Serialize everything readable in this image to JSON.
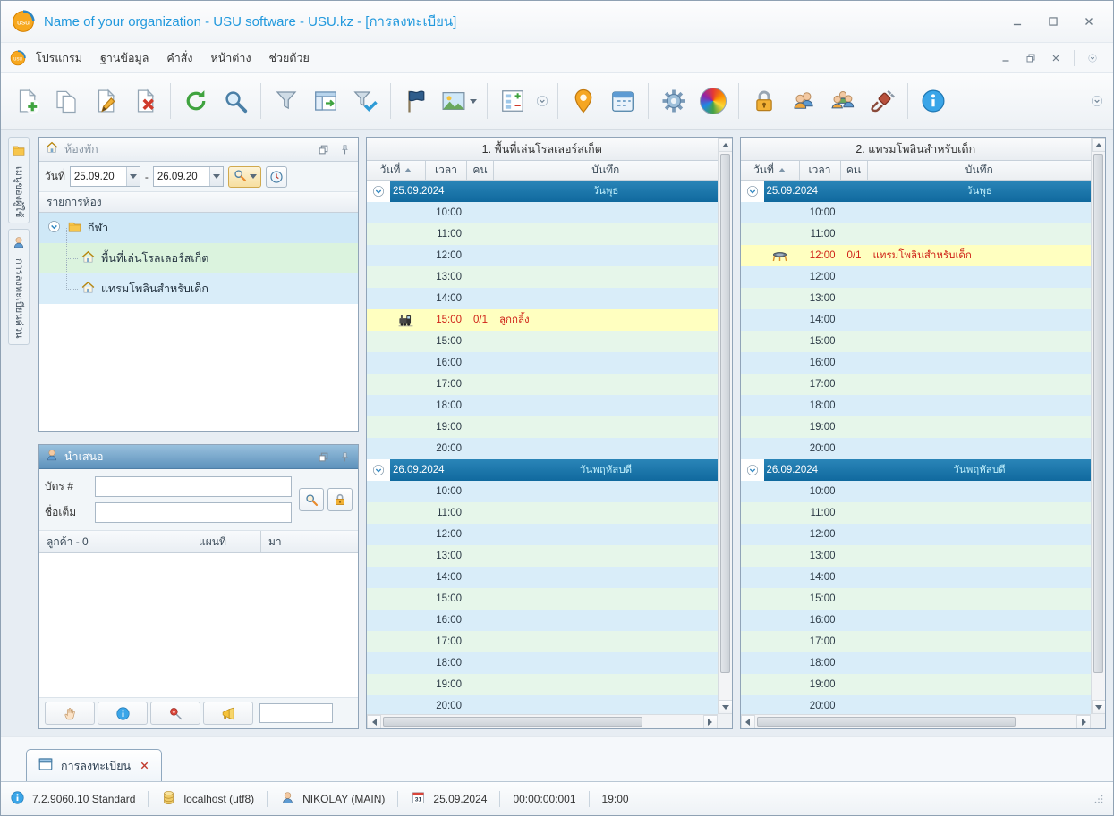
{
  "colors": {
    "title_text": "#2299dd",
    "date_band": "#10699e",
    "row_blue": "#d9edf9",
    "row_green": "#e6f6ea",
    "booking_bg": "#ffffc0",
    "booking_text": "#cf2217"
  },
  "titlebar": {
    "title": "Name of your organization - USU software - USU.kz - [การลงทะเบียน]"
  },
  "menubar": {
    "items": [
      "โปรแกรม",
      "ฐานข้อมูล",
      "คำสั่ง",
      "หน้าต่าง",
      "ช่วยด้วย"
    ]
  },
  "toolbar": {
    "groups": [
      [
        "add",
        "copy",
        "edit",
        "delete"
      ],
      [
        "refresh",
        "search"
      ],
      [
        "filter",
        "layout",
        "filter-check"
      ],
      [
        "flag",
        "image-drop"
      ],
      [
        "counter",
        "chevron-sm"
      ],
      [
        "location",
        "calendar"
      ],
      [
        "settings",
        "colorwheel"
      ],
      [
        "lock",
        "users2",
        "users3",
        "plug"
      ],
      [
        "info"
      ]
    ]
  },
  "dock_tabs": [
    {
      "label": "เมนูของผู้ใช้",
      "icon": "folder-icon"
    },
    {
      "label": "การลงทะเบียนด่วน",
      "icon": "person-icon"
    }
  ],
  "rooms_panel": {
    "title": "ห้องพัก",
    "date_label": "วันที่",
    "date_from": "25.09.20",
    "date_to": "26.09.20",
    "list_header": "รายการห้อง",
    "group": "กีฬา",
    "rooms": [
      "พื้นที่เล่นโรลเลอร์สเก็ต",
      "แทรมโพลินสำหรับเด็ก"
    ]
  },
  "present_panel": {
    "title": "นำเสนอ",
    "card_label": "บัตร #",
    "fullname_label": "ชื่อเต็ม",
    "columns": [
      "ลูกค้า - 0",
      "แผนที่",
      "มา"
    ]
  },
  "schedules": {
    "columns": {
      "date": "วันที่",
      "time": "เวลา",
      "people": "คน",
      "note": "บันทึก"
    },
    "times": [
      "10:00",
      "11:00",
      "12:00",
      "13:00",
      "14:00",
      "15:00",
      "16:00",
      "17:00",
      "18:00",
      "19:00",
      "20:00"
    ],
    "panels": [
      {
        "title": "1. พื้นที่เล่นโรลเลอร์สเก็ต",
        "days": [
          {
            "date": "25.09.2024",
            "weekday": "วันพุธ",
            "bookings": [
              {
                "before": "15:00",
                "time": "15:00",
                "people": "0/1",
                "note": "ลูกกลิ้ง",
                "icon": "train-icon"
              }
            ]
          },
          {
            "date": "26.09.2024",
            "weekday": "วันพฤหัสบดี",
            "bookings": []
          }
        ]
      },
      {
        "title": "2. แทรมโพลินสำหรับเด็ก",
        "days": [
          {
            "date": "25.09.2024",
            "weekday": "วันพุธ",
            "bookings": [
              {
                "before": "12:00",
                "time": "12:00",
                "people": "0/1",
                "note": "แทรมโพลินสำหรับเด็ก",
                "icon": "trampoline-icon"
              }
            ]
          },
          {
            "date": "26.09.2024",
            "weekday": "วันพฤหัสบดี",
            "bookings": []
          }
        ]
      }
    ]
  },
  "bottom_tabs": [
    {
      "label": "การลงทะเบียน",
      "active": true
    }
  ],
  "statusbar": {
    "version": "7.2.9060.10 Standard",
    "database": "localhost (utf8)",
    "user": "NIKOLAY (MAIN)",
    "date": "25.09.2024",
    "calendar_day": "31",
    "timer": "00:00:00:001",
    "time": "19:00"
  }
}
